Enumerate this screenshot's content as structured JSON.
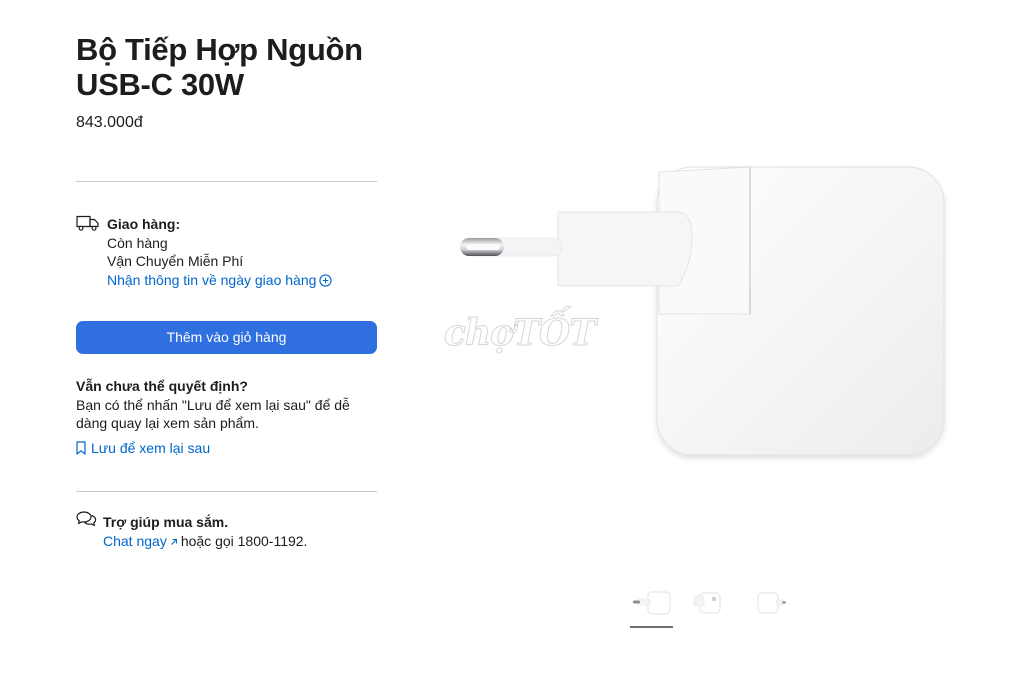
{
  "product": {
    "title_line1": "Bộ Tiếp Hợp Nguồn",
    "title_line2": "USB-C 30W",
    "price": "843.000đ"
  },
  "delivery": {
    "heading": "Giao hàng:",
    "stock": "Còn hàng",
    "shipping": "Vận Chuyển Miễn Phí",
    "info_link": "Nhận thông tin về ngày giao hàng",
    "icon": "truck-icon"
  },
  "cart": {
    "add_label": "Thêm vào giỏ hàng",
    "accent": "#2f6fdf"
  },
  "undecided": {
    "question": "Vẫn chưa thể quyết định?",
    "description": "Bạn có thể nhấn \"Lưu để xem lại sau\" để dễ dàng quay lại xem sản phẩm.",
    "save_link": "Lưu để xem lại sau",
    "icon": "bookmark-icon"
  },
  "help": {
    "heading": "Trợ giúp mua sắm.",
    "chat_link": "Chat ngay",
    "call_text": "hoặc gọi 1800-1192.",
    "icon": "chat-bubbles-icon"
  },
  "gallery": {
    "watermark": "chợTỐT",
    "thumbnails": [
      "thumbnail-1",
      "thumbnail-2",
      "thumbnail-3"
    ],
    "active_index": 0
  }
}
